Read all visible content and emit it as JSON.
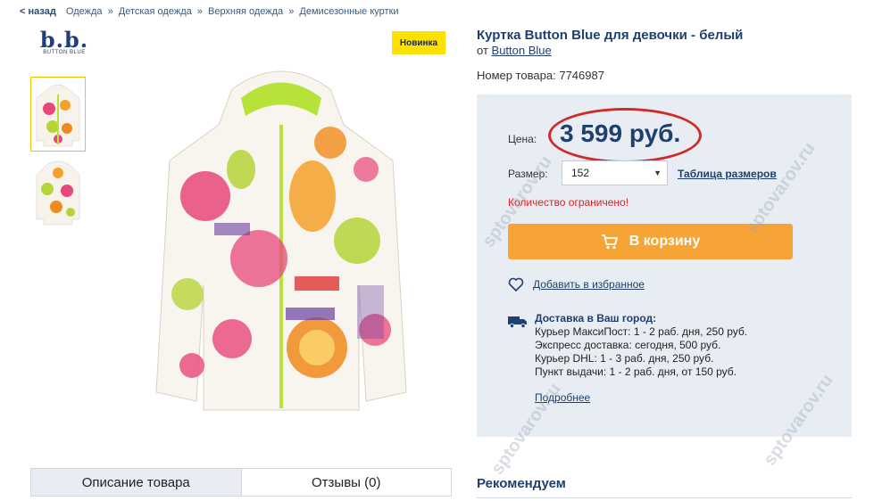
{
  "breadcrumb": {
    "back": "< назад",
    "items": [
      "Одежда",
      "Детская одежда",
      "Верхняя одежда",
      "Демисезонные куртки"
    ],
    "separator": "»"
  },
  "brand": {
    "logo_text": "b.b.",
    "logo_sub": "BUTTON BLUE"
  },
  "badge": {
    "label": "Новинка"
  },
  "product": {
    "title": "Куртка Button Blue для девочки - белый",
    "by_prefix": "от",
    "brand_link": "Button Blue",
    "sku": "Номер товара: 7746987"
  },
  "price": {
    "label": "Цена:",
    "value": "3 599 руб."
  },
  "size": {
    "label": "Размер:",
    "selected": "152",
    "table_link": "Таблица размеров"
  },
  "stock": {
    "notice": "Количество ограничено!"
  },
  "cart": {
    "button_label": "В корзину"
  },
  "favorite": {
    "label": "Добавить в избранное"
  },
  "delivery": {
    "title": "Доставка в Ваш город:",
    "options": [
      "Курьер МаксиПост: 1 - 2 раб. дня, 250 руб.",
      "Экспресс доставка: сегодня, 500 руб.",
      "Курьер DHL: 1 - 3 раб. дня, 250 руб.",
      "Пункт выдачи: 1 - 2 раб. дня, от 150 руб."
    ],
    "more_link": "Подробнее"
  },
  "tabs": [
    {
      "label": "Описание товара"
    },
    {
      "label": "Отзывы (0)"
    }
  ],
  "recommend": {
    "title": "Рекомендуем"
  },
  "watermark": {
    "text": "sptovarov.ru"
  },
  "colors": {
    "brand_blue": "#1f3f6e",
    "accent_orange": "#f7a436",
    "badge_yellow": "#ffe100",
    "warning_red": "#e02020",
    "panel_bg": "#e8edf3"
  }
}
